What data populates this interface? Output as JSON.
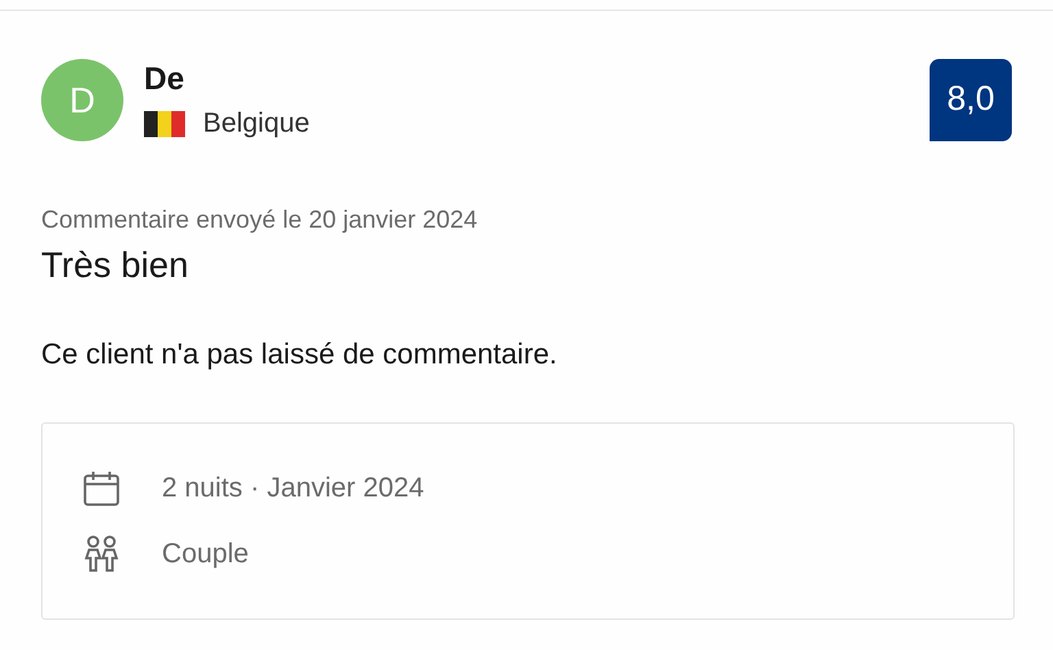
{
  "review": {
    "reviewer": {
      "initial": "D",
      "name": "De",
      "country": "Belgique"
    },
    "score": "8,0",
    "date": "Commentaire envoyé le 20 janvier 2024",
    "title": "Très bien",
    "comment": "Ce client n'a pas laissé de commentaire.",
    "stay": [
      {
        "kind": "calendar",
        "text": "2 nuits · Janvier 2024"
      },
      {
        "kind": "people",
        "text": "Couple"
      }
    ]
  }
}
